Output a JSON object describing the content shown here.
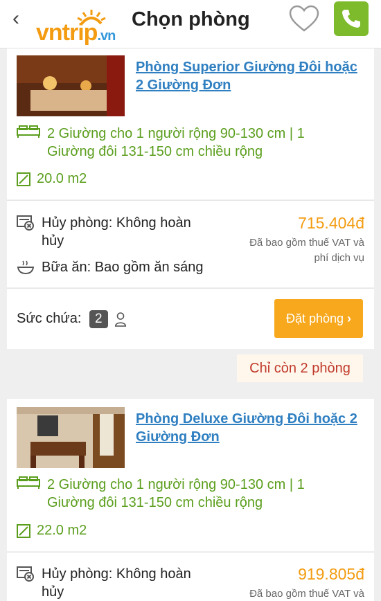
{
  "header": {
    "title": "Chọn phòng",
    "logo": {
      "main": "vntrip",
      "suffix": ".vn"
    },
    "back_icon": "chevron-left-icon",
    "favorite_icon": "heart-outline-icon",
    "call_icon": "phone-icon",
    "colors": {
      "accent": "#f39c12",
      "call": "#7dbb2c",
      "link": "#2f7fc1",
      "green": "#5b9e1d"
    }
  },
  "rooms": [
    {
      "name": "Phòng Superior Giường Đôi hoặc 2 Giường Đơn",
      "beds": "2 Giường cho 1 người rộng 90-130 cm | 1 Giường đôi 131-150 cm chiều rộng",
      "area": "20.0 m2",
      "cancel": "Hủy phòng: Không hoàn hủy",
      "meal": "Bữa ăn: Bao gồm ăn sáng",
      "price": "715.404đ",
      "price_note": "Đã bao gồm thuế VAT và phí dịch vụ",
      "capacity_label": "Sức chứa:",
      "capacity": "2",
      "book_label": "Đặt phòng",
      "remaining": "Chỉ còn 2 phòng"
    },
    {
      "name": "Phòng Deluxe Giường Đôi hoặc 2 Giường Đơn",
      "beds": "2 Giường cho 1 người rộng 90-130 cm | 1 Giường đôi 131-150 cm chiều rộng",
      "area": "22.0 m2",
      "cancel": "Hủy phòng: Không hoàn hủy",
      "price": "919.805đ",
      "price_note": "Đã bao gồm thuế VAT và"
    }
  ]
}
